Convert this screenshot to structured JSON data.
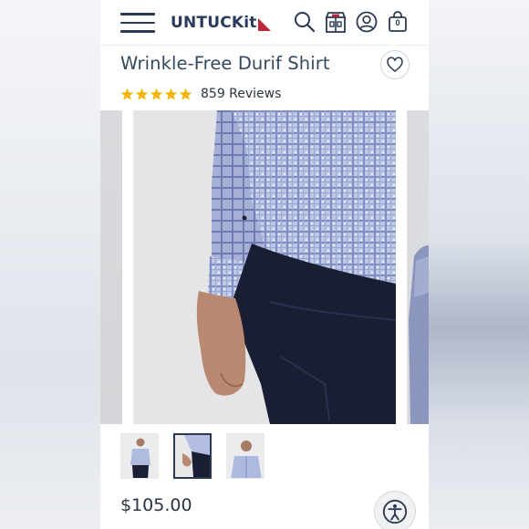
{
  "header": {
    "brand": "UNTUCKit",
    "bag_count": "0",
    "icons": [
      "menu-icon",
      "search-icon",
      "store-icon",
      "account-icon",
      "bag-icon"
    ]
  },
  "product": {
    "title": "Wrinkle-Free Durif Shirt",
    "rating": 5,
    "rating_max": 5,
    "reviews": "859 Reviews",
    "price": "$105.00"
  },
  "gallery": {
    "thumbnail_count": 3,
    "selected_thumbnail": 2
  },
  "colors": {
    "brand_navy": "#2a3a5c",
    "brand_red": "#c0283a",
    "star_gold": "#f3b70d"
  }
}
